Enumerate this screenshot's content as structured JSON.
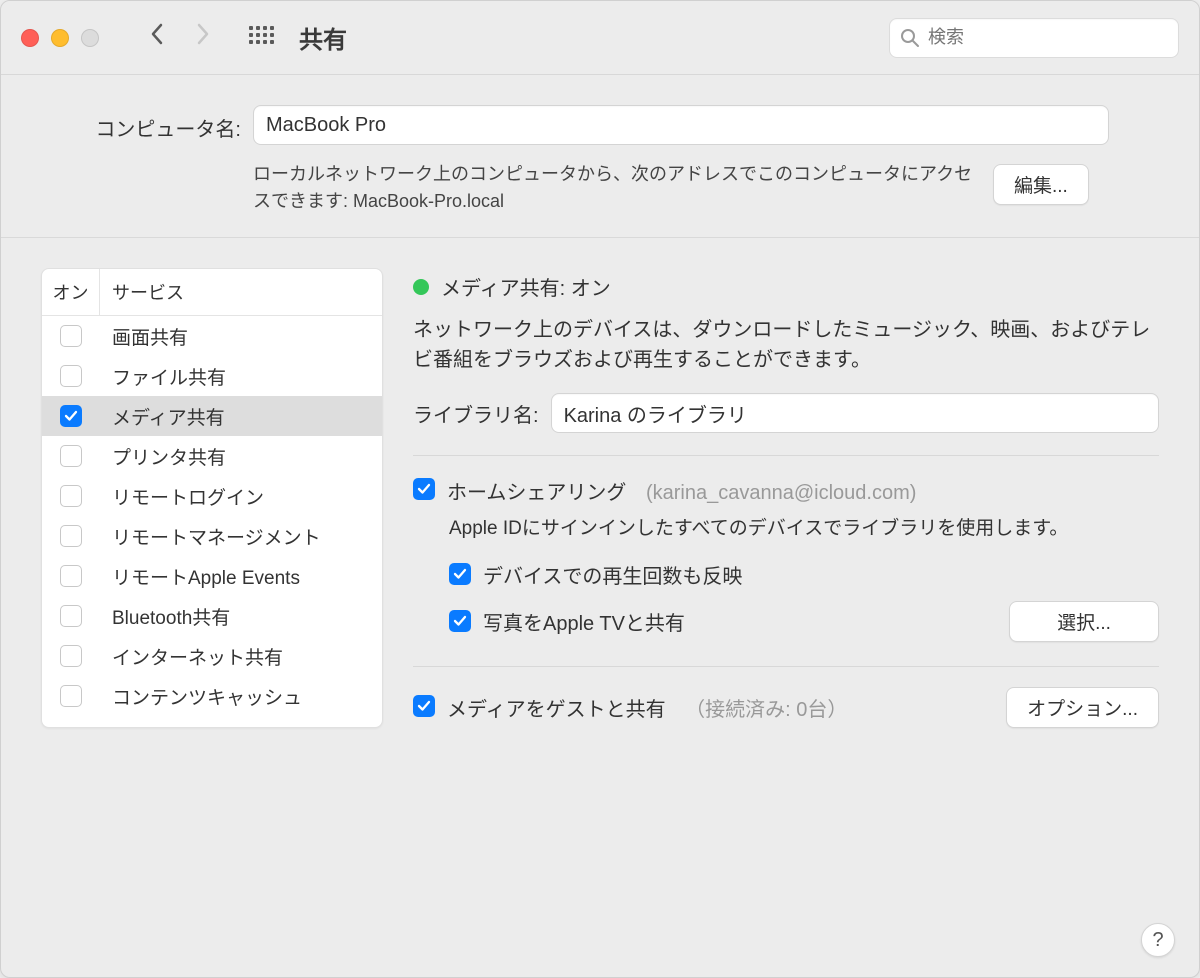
{
  "titlebar": {
    "title": "共有",
    "search_placeholder": "検索"
  },
  "top": {
    "computer_name_label": "コンピュータ名:",
    "computer_name": "MacBook Pro",
    "access_desc": "ローカルネットワーク上のコンピュータから、次のアドレスでこのコンピュータにアクセスできます: MacBook-Pro.local",
    "edit_button": "編集..."
  },
  "services": {
    "col_on": "オン",
    "col_service": "サービス",
    "items": [
      {
        "label": "画面共有",
        "on": false
      },
      {
        "label": "ファイル共有",
        "on": false
      },
      {
        "label": "メディア共有",
        "on": true,
        "selected": true
      },
      {
        "label": "プリンタ共有",
        "on": false
      },
      {
        "label": "リモートログイン",
        "on": false
      },
      {
        "label": "リモートマネージメント",
        "on": false
      },
      {
        "label": "リモートApple Events",
        "on": false
      },
      {
        "label": "Bluetooth共有",
        "on": false
      },
      {
        "label": "インターネット共有",
        "on": false
      },
      {
        "label": "コンテンツキャッシュ",
        "on": false
      }
    ]
  },
  "detail": {
    "status_text": "メディア共有: オン",
    "desc": "ネットワーク上のデバイスは、ダウンロードしたミュージック、映画、およびテレビ番組をブラウズおよび再生することができます。",
    "library_label": "ライブラリ名:",
    "library_name": "Karina のライブラリ",
    "home_sharing_label": "ホームシェアリング",
    "home_sharing_account": "(karina_cavanna@icloud.com)",
    "home_sharing_desc": "Apple IDにサインインしたすべてのデバイスでライブラリを使用します。",
    "play_count_label": "デバイスでの再生回数も反映",
    "photos_label": "写真をApple TVと共有",
    "select_button": "選択...",
    "guest_label": "メディアをゲストと共有",
    "guest_status": "（接続済み: 0台）",
    "options_button": "オプション..."
  },
  "help": "?"
}
